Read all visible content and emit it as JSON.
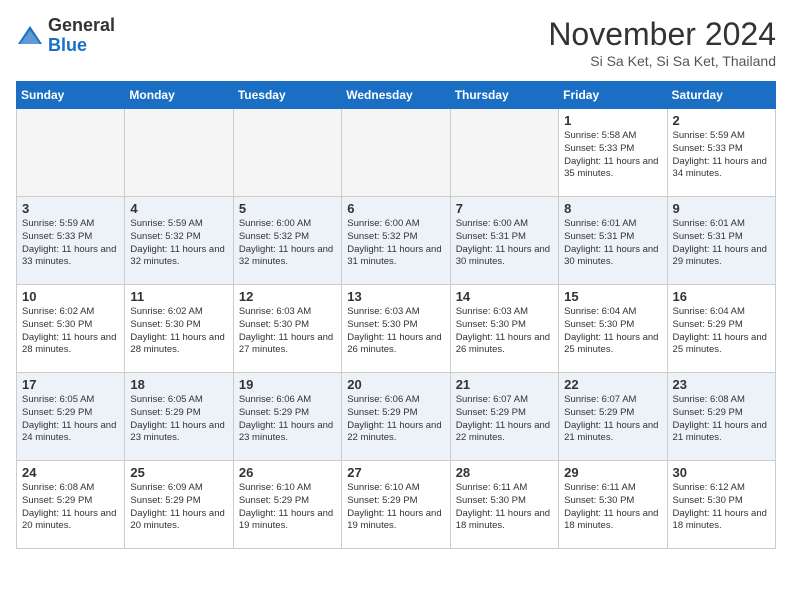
{
  "logo": {
    "general": "General",
    "blue": "Blue"
  },
  "header": {
    "month": "November 2024",
    "location": "Si Sa Ket, Si Sa Ket, Thailand"
  },
  "weekdays": [
    "Sunday",
    "Monday",
    "Tuesday",
    "Wednesday",
    "Thursday",
    "Friday",
    "Saturday"
  ],
  "weeks": [
    [
      {
        "day": "",
        "info": ""
      },
      {
        "day": "",
        "info": ""
      },
      {
        "day": "",
        "info": ""
      },
      {
        "day": "",
        "info": ""
      },
      {
        "day": "",
        "info": ""
      },
      {
        "day": "1",
        "info": "Sunrise: 5:58 AM\nSunset: 5:33 PM\nDaylight: 11 hours and 35 minutes."
      },
      {
        "day": "2",
        "info": "Sunrise: 5:59 AM\nSunset: 5:33 PM\nDaylight: 11 hours and 34 minutes."
      }
    ],
    [
      {
        "day": "3",
        "info": "Sunrise: 5:59 AM\nSunset: 5:33 PM\nDaylight: 11 hours and 33 minutes."
      },
      {
        "day": "4",
        "info": "Sunrise: 5:59 AM\nSunset: 5:32 PM\nDaylight: 11 hours and 32 minutes."
      },
      {
        "day": "5",
        "info": "Sunrise: 6:00 AM\nSunset: 5:32 PM\nDaylight: 11 hours and 32 minutes."
      },
      {
        "day": "6",
        "info": "Sunrise: 6:00 AM\nSunset: 5:32 PM\nDaylight: 11 hours and 31 minutes."
      },
      {
        "day": "7",
        "info": "Sunrise: 6:00 AM\nSunset: 5:31 PM\nDaylight: 11 hours and 30 minutes."
      },
      {
        "day": "8",
        "info": "Sunrise: 6:01 AM\nSunset: 5:31 PM\nDaylight: 11 hours and 30 minutes."
      },
      {
        "day": "9",
        "info": "Sunrise: 6:01 AM\nSunset: 5:31 PM\nDaylight: 11 hours and 29 minutes."
      }
    ],
    [
      {
        "day": "10",
        "info": "Sunrise: 6:02 AM\nSunset: 5:30 PM\nDaylight: 11 hours and 28 minutes."
      },
      {
        "day": "11",
        "info": "Sunrise: 6:02 AM\nSunset: 5:30 PM\nDaylight: 11 hours and 28 minutes."
      },
      {
        "day": "12",
        "info": "Sunrise: 6:03 AM\nSunset: 5:30 PM\nDaylight: 11 hours and 27 minutes."
      },
      {
        "day": "13",
        "info": "Sunrise: 6:03 AM\nSunset: 5:30 PM\nDaylight: 11 hours and 26 minutes."
      },
      {
        "day": "14",
        "info": "Sunrise: 6:03 AM\nSunset: 5:30 PM\nDaylight: 11 hours and 26 minutes."
      },
      {
        "day": "15",
        "info": "Sunrise: 6:04 AM\nSunset: 5:30 PM\nDaylight: 11 hours and 25 minutes."
      },
      {
        "day": "16",
        "info": "Sunrise: 6:04 AM\nSunset: 5:29 PM\nDaylight: 11 hours and 25 minutes."
      }
    ],
    [
      {
        "day": "17",
        "info": "Sunrise: 6:05 AM\nSunset: 5:29 PM\nDaylight: 11 hours and 24 minutes."
      },
      {
        "day": "18",
        "info": "Sunrise: 6:05 AM\nSunset: 5:29 PM\nDaylight: 11 hours and 23 minutes."
      },
      {
        "day": "19",
        "info": "Sunrise: 6:06 AM\nSunset: 5:29 PM\nDaylight: 11 hours and 23 minutes."
      },
      {
        "day": "20",
        "info": "Sunrise: 6:06 AM\nSunset: 5:29 PM\nDaylight: 11 hours and 22 minutes."
      },
      {
        "day": "21",
        "info": "Sunrise: 6:07 AM\nSunset: 5:29 PM\nDaylight: 11 hours and 22 minutes."
      },
      {
        "day": "22",
        "info": "Sunrise: 6:07 AM\nSunset: 5:29 PM\nDaylight: 11 hours and 21 minutes."
      },
      {
        "day": "23",
        "info": "Sunrise: 6:08 AM\nSunset: 5:29 PM\nDaylight: 11 hours and 21 minutes."
      }
    ],
    [
      {
        "day": "24",
        "info": "Sunrise: 6:08 AM\nSunset: 5:29 PM\nDaylight: 11 hours and 20 minutes."
      },
      {
        "day": "25",
        "info": "Sunrise: 6:09 AM\nSunset: 5:29 PM\nDaylight: 11 hours and 20 minutes."
      },
      {
        "day": "26",
        "info": "Sunrise: 6:10 AM\nSunset: 5:29 PM\nDaylight: 11 hours and 19 minutes."
      },
      {
        "day": "27",
        "info": "Sunrise: 6:10 AM\nSunset: 5:29 PM\nDaylight: 11 hours and 19 minutes."
      },
      {
        "day": "28",
        "info": "Sunrise: 6:11 AM\nSunset: 5:30 PM\nDaylight: 11 hours and 18 minutes."
      },
      {
        "day": "29",
        "info": "Sunrise: 6:11 AM\nSunset: 5:30 PM\nDaylight: 11 hours and 18 minutes."
      },
      {
        "day": "30",
        "info": "Sunrise: 6:12 AM\nSunset: 5:30 PM\nDaylight: 11 hours and 18 minutes."
      }
    ]
  ]
}
